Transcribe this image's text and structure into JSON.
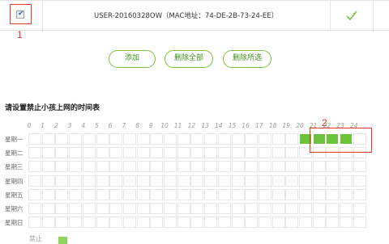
{
  "device": {
    "name_mac": "USER-20160328OW（MAC地址：74-DE-2B-73-24-EE）",
    "selected": true
  },
  "annotations": {
    "marker1": "1",
    "marker2": "2"
  },
  "buttons": {
    "add": "添加",
    "delete_all": "删除全部",
    "delete_selected": "删除所选"
  },
  "schedule": {
    "title": "请设置禁止小孩上网的时间表",
    "hours": [
      "0",
      "1",
      "2",
      "3",
      "4",
      "5",
      "6",
      "7",
      "8",
      "9",
      "10",
      "11",
      "12",
      "13",
      "14",
      "15",
      "16",
      "17",
      "18",
      "19",
      "20",
      "21",
      "22",
      "23",
      "24"
    ],
    "days": [
      "星期一",
      "星期二",
      "星期三",
      "星期四",
      "星期五",
      "星期六",
      "星期日"
    ],
    "blocked": [
      {
        "day": "星期一",
        "hours": [
          20,
          21,
          22,
          23
        ]
      }
    ],
    "legend_label": "禁止"
  },
  "colors": {
    "accent": "#7cc23b",
    "blocked": "#6dc23b",
    "marker": "#e23b2e"
  }
}
